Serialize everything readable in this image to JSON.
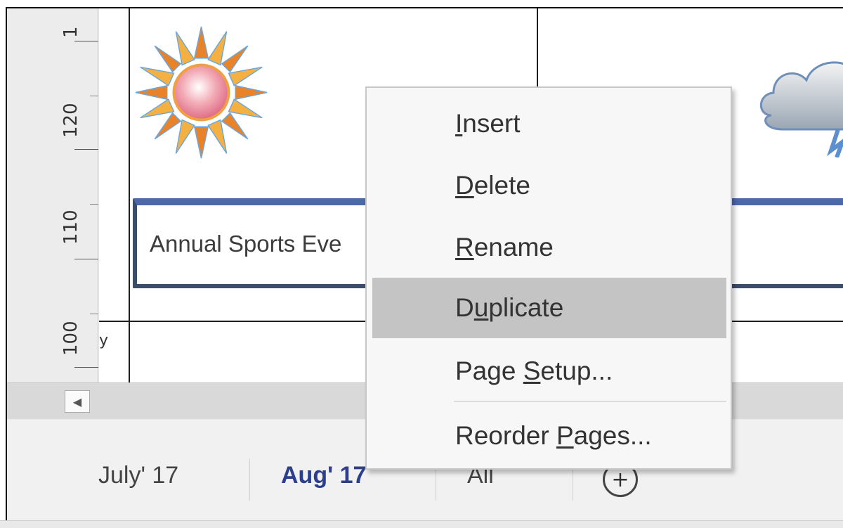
{
  "ruler": {
    "labels": [
      "1",
      "120",
      "110",
      "100"
    ]
  },
  "canvas": {
    "event_text": "Annual Sports Eve",
    "small_mark": "y",
    "sun_icon": "sun-icon",
    "cloud_icon": "cloud-icon"
  },
  "scroll": {
    "left_arrow": "◀"
  },
  "tabs": {
    "items": [
      "July' 17",
      "Aug' 17",
      "All"
    ],
    "active": "Aug' 17",
    "add_icon": "+"
  },
  "context_menu": {
    "items": [
      {
        "pre": "",
        "u": "I",
        "post": "nsert"
      },
      {
        "pre": "",
        "u": "D",
        "post": "elete"
      },
      {
        "pre": "",
        "u": "R",
        "post": "ename"
      },
      {
        "pre": "D",
        "u": "u",
        "post": "plicate"
      },
      {
        "pre": "Page ",
        "u": "S",
        "post": "etup..."
      },
      {
        "pre": "Reorder ",
        "u": "P",
        "post": "ages..."
      }
    ],
    "highlighted": "Duplicate"
  },
  "colors": {
    "event_border": "#3b4d6e",
    "event_top": "#4a69a6",
    "active_tab": "#2b3f8f",
    "menu_highlight": "#c4c4c4"
  }
}
